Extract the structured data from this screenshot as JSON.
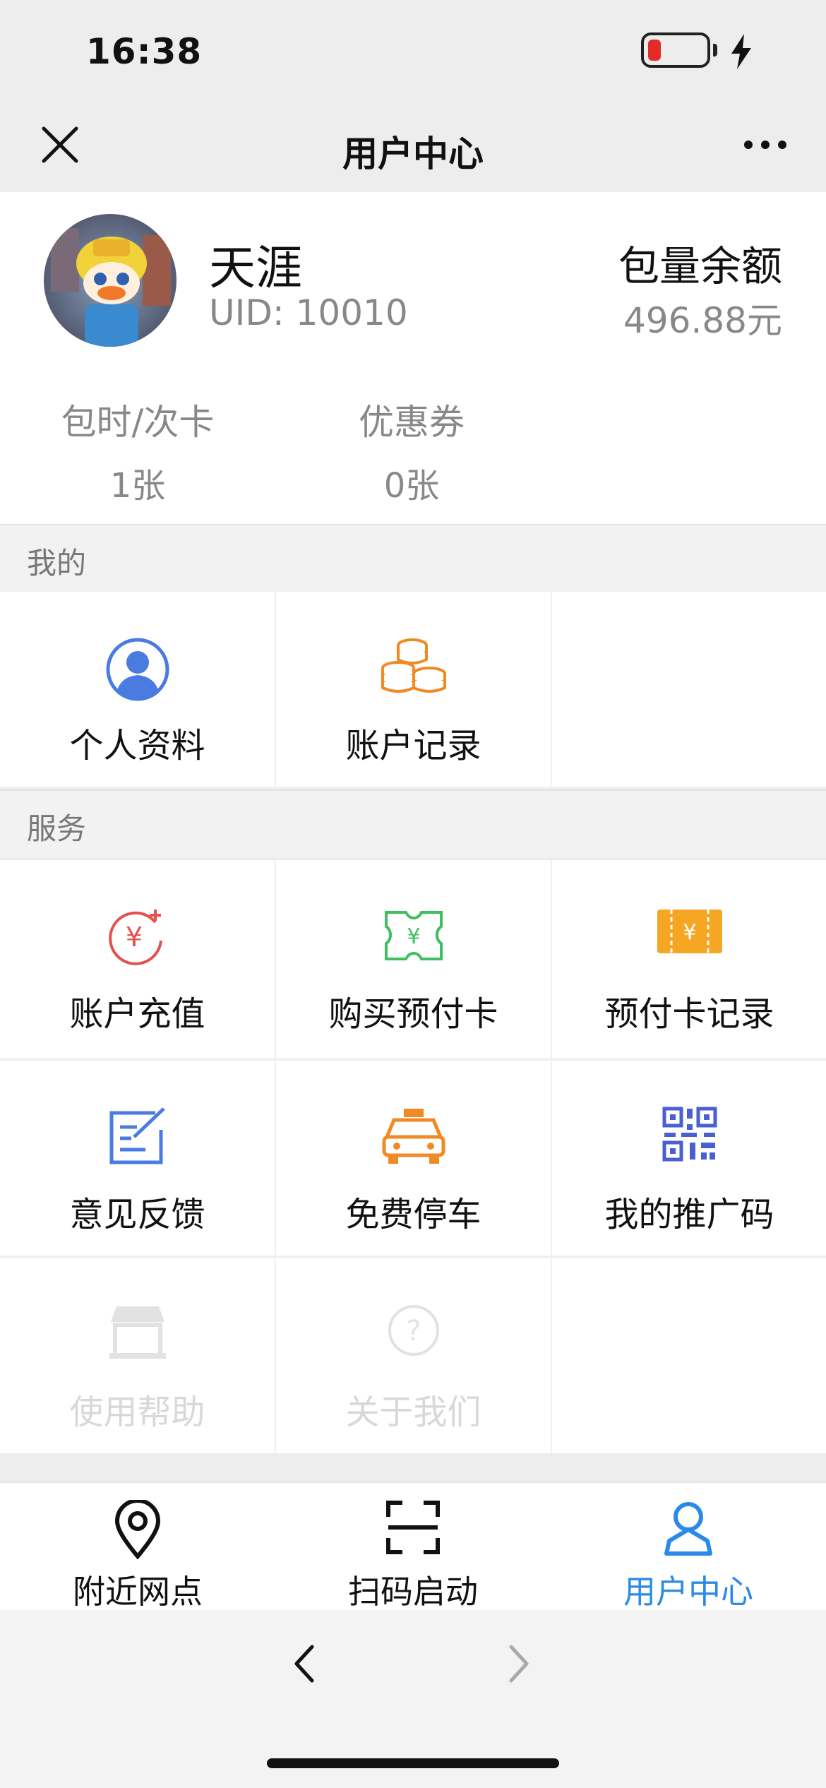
{
  "status_bar": {
    "time": "16:38"
  },
  "nav": {
    "title": "用户中心",
    "close_icon": "close-icon",
    "more_icon": "more-icon"
  },
  "profile": {
    "name": "天涯",
    "uid": "UID: 10010",
    "balance_label": "包量余额",
    "balance_value": "496.88元",
    "stats": [
      {
        "label": "包时/次卡",
        "value": "1张"
      },
      {
        "label": "优惠券",
        "value": "0张"
      }
    ]
  },
  "sections": {
    "mine": {
      "title": "我的",
      "items": [
        {
          "label": "个人资料",
          "icon": "profile-icon"
        },
        {
          "label": "账户记录",
          "icon": "coins-icon"
        }
      ]
    },
    "services": {
      "title": "服务",
      "items": [
        {
          "label": "账户充值",
          "icon": "recharge-icon"
        },
        {
          "label": "购买预付卡",
          "icon": "prepaid-ticket-icon"
        },
        {
          "label": "预付卡记录",
          "icon": "card-record-icon"
        },
        {
          "label": "意见反馈",
          "icon": "feedback-icon"
        },
        {
          "label": "免费停车",
          "icon": "taxi-icon"
        },
        {
          "label": "我的推广码",
          "icon": "qrcode-icon"
        },
        {
          "label": "使用帮助",
          "icon": "shop-icon"
        },
        {
          "label": "关于我们",
          "icon": "question-icon"
        }
      ]
    }
  },
  "tabbar": {
    "items": [
      {
        "label": "附近网点",
        "icon": "location-pin-icon"
      },
      {
        "label": "扫码启动",
        "icon": "scan-icon"
      },
      {
        "label": "用户中心",
        "icon": "user-icon"
      }
    ],
    "active_color": "#2b8ae8"
  },
  "colors": {
    "blue": "#4a7be0",
    "orange": "#f08a24",
    "green": "#3fbf5f",
    "red": "#e45050",
    "gold": "#f5a623",
    "accent": "#2b8ae8"
  }
}
